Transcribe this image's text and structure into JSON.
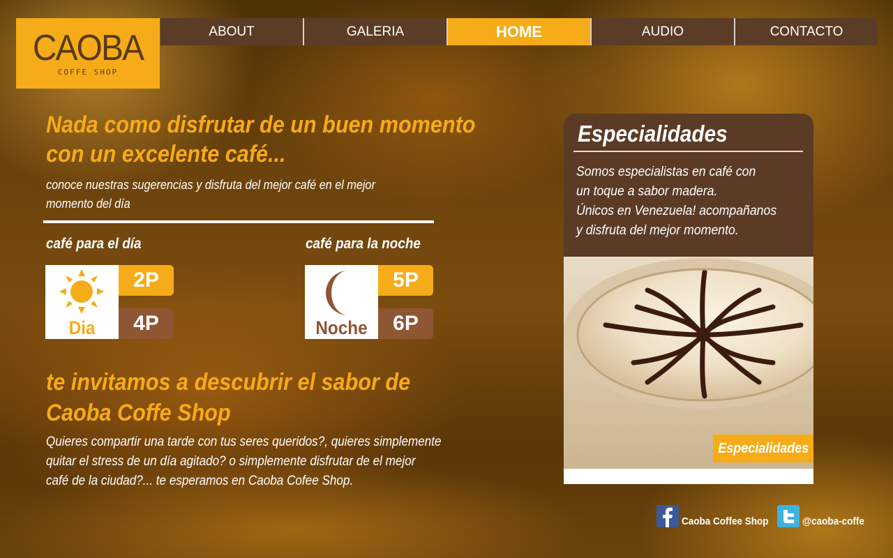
{
  "logo": {
    "main": "CAOBA",
    "sub": "COFFE SHOP"
  },
  "nav": {
    "items": [
      "ABOUT",
      "GALERIA",
      "HOME",
      "AUDIO",
      "CONTACTO"
    ],
    "active": "HOME"
  },
  "hero": {
    "headline_line1": "Nada como disfrutar de un buen momento",
    "headline_line2": "con un excelente café...",
    "subline": "conoce nuestras sugerencias y disfruta del mejor café en el mejor momento del día"
  },
  "day": {
    "label": "café para el día",
    "icon_text": "Dia",
    "times": [
      "2P",
      "4P"
    ]
  },
  "night": {
    "label": "café para la noche",
    "icon_text": "Noche",
    "times": [
      "5P",
      "6P"
    ]
  },
  "invite": {
    "headline_line1": "te invitamos a descubrir el sabor de",
    "headline_line2": "Caoba Coffe Shop",
    "body_line1": "Quieres compartir una tarde con tus seres queridos?, quieres simplemente",
    "body_line2": "quitar el stress de un día agitado? o simplemente disfrutar de el mejor",
    "body_line3": "café de la ciudad?... te esperamos en Caoba Cofee Shop."
  },
  "specialties": {
    "title": "Especialidades",
    "line1": "Somos especialistas en café con",
    "line2": "un toque a sabor madera.",
    "line3": "Únicos en Venezuela! acompañanos",
    "line4": "y disfruta del mejor momento.",
    "badge": "Especialidades"
  },
  "social": {
    "facebook_label": "Caoba Coffee Shop",
    "twitter_label": "@caoba-coffe"
  },
  "colors": {
    "accent": "#f5ac18",
    "brown_dark": "#5b3b26",
    "brown_chip": "#8e5632"
  },
  "icons": [
    "sun-icon",
    "moon-icon",
    "facebook-icon",
    "twitter-icon"
  ]
}
